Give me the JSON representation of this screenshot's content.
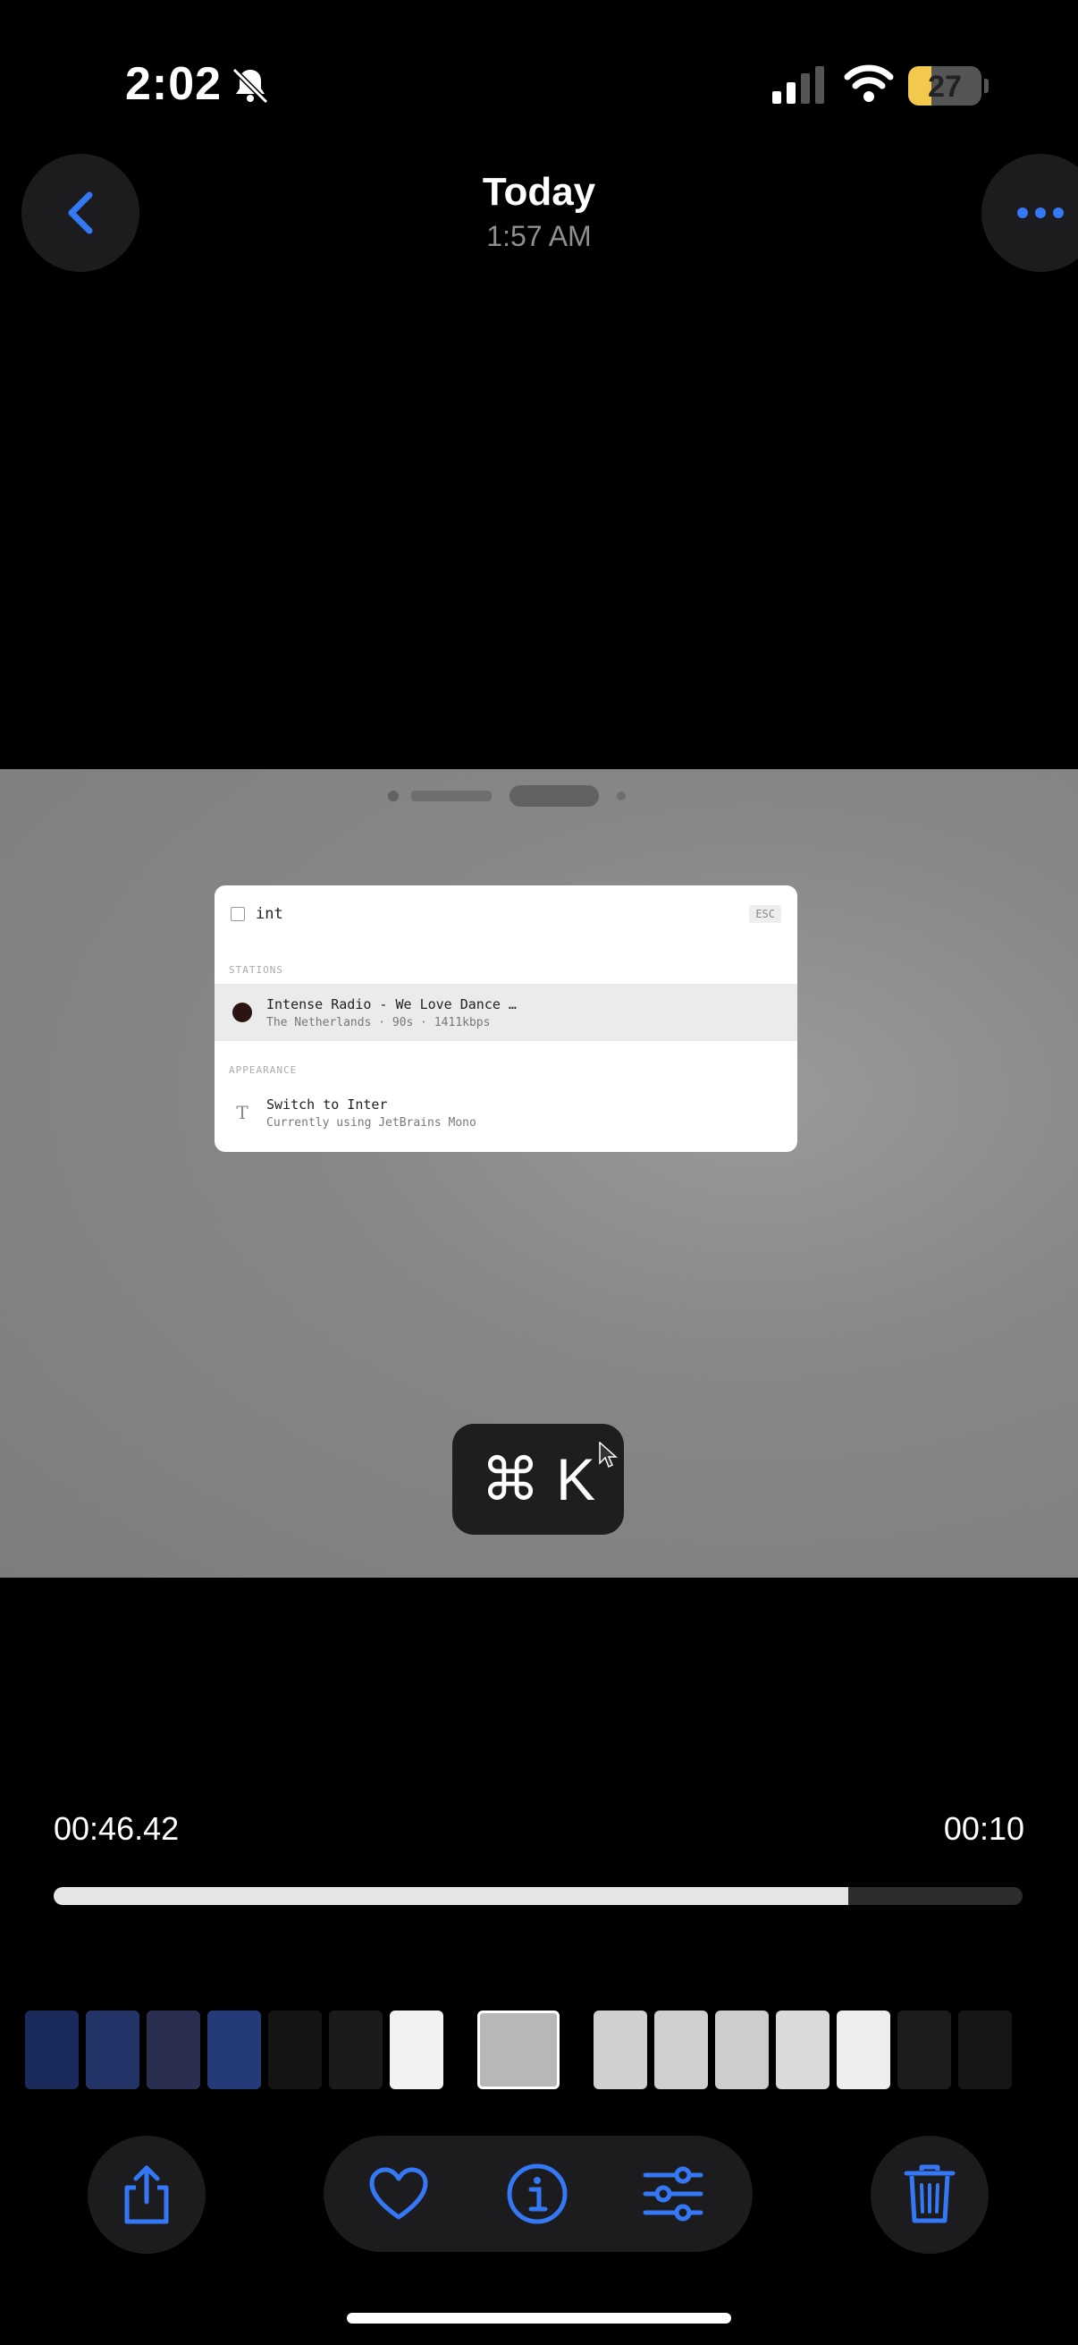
{
  "status_bar": {
    "time": "2:02",
    "battery": "27"
  },
  "header": {
    "title": "Today",
    "subtitle": "1:57 AM"
  },
  "icons": {
    "back": "chevron-left-icon",
    "more": "ellipsis-icon",
    "bell": "bell-slash-icon",
    "share": "share-icon",
    "favorite": "heart-icon",
    "info": "info-icon",
    "adjust": "sliders-icon",
    "delete": "trash-icon"
  },
  "colors": {
    "accent": "#3478f6",
    "battery": "#f2c94c",
    "background": "#000000"
  },
  "video_frame": {
    "palette": {
      "query": "int",
      "esc": "ESC",
      "sections": [
        {
          "label": "STATIONS",
          "items": [
            {
              "title": "Intense Radio - We Love Dance …",
              "subtitle": "The Netherlands · 90s · 1411kbps"
            }
          ]
        },
        {
          "label": "APPEARANCE",
          "items": [
            {
              "title": "Switch to Inter",
              "subtitle": "Currently using JetBrains Mono"
            }
          ]
        }
      ]
    },
    "shortcut": {
      "symbol": "⌘",
      "key": "K"
    }
  },
  "playback": {
    "elapsed": "00:46.42",
    "remaining": "00:10",
    "progress": 0.82
  }
}
